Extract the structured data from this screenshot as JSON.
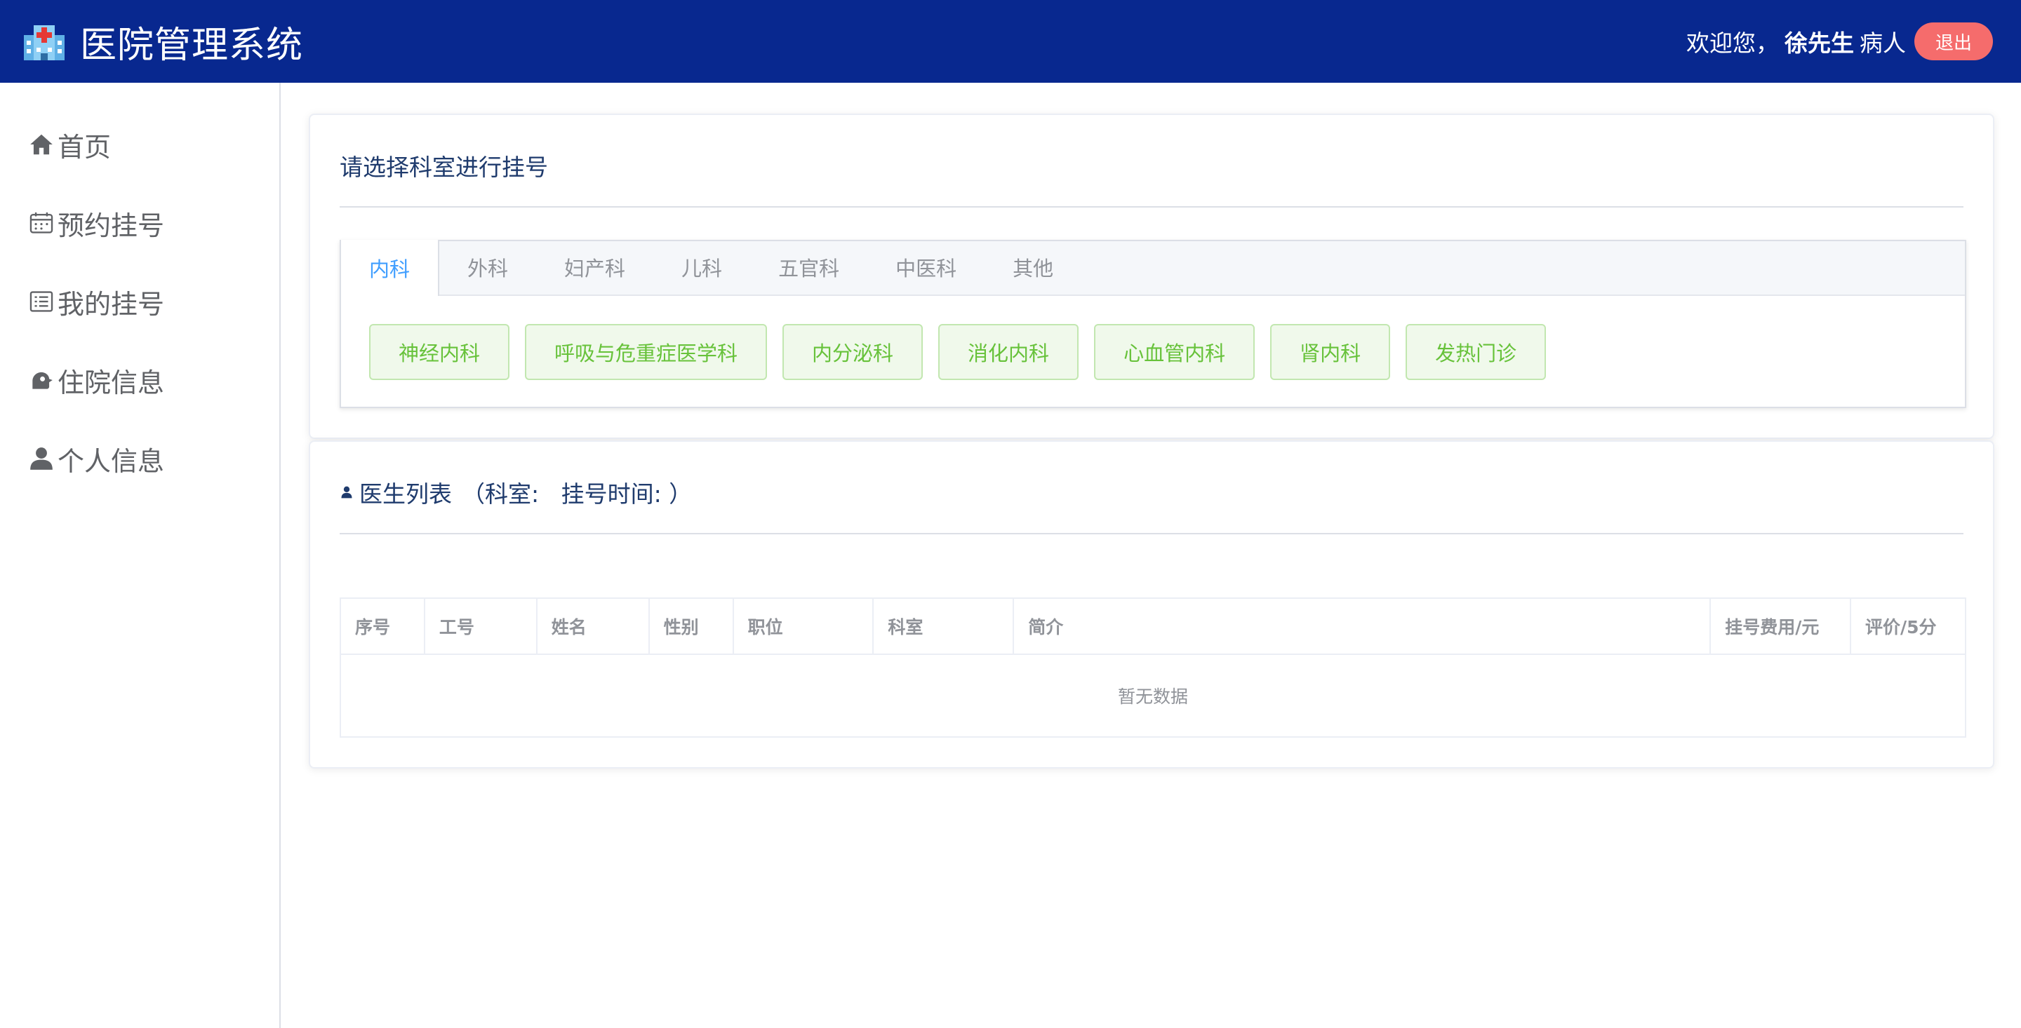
{
  "header": {
    "title": "医院管理系统",
    "welcome": "欢迎您，",
    "user_name": "徐先生",
    "role": "病人",
    "logout_label": "退出"
  },
  "sidebar": {
    "items": [
      {
        "label": "首页",
        "icon": "home-icon"
      },
      {
        "label": "预约挂号",
        "icon": "calendar-icon"
      },
      {
        "label": "我的挂号",
        "icon": "list-icon"
      },
      {
        "label": "住院信息",
        "icon": "bed-icon"
      },
      {
        "label": " 个人信息",
        "icon": "user-icon"
      }
    ]
  },
  "department_card": {
    "title": "请选择科室进行挂号",
    "tabs": [
      "内科",
      "外科",
      "妇产科",
      "儿科",
      "五官科",
      "中医科",
      "其他"
    ],
    "active_tab": "内科",
    "departments": [
      "神经内科",
      "呼吸与危重症医学科",
      "内分泌科",
      "消化内科",
      "心血管内科",
      "肾内科",
      "发热门诊"
    ]
  },
  "doctor_card": {
    "title": "医生列表",
    "subtitle": "（科室:   挂号时间: ）",
    "columns": [
      "序号",
      "工号",
      "姓名",
      "性别",
      "职位",
      "科室",
      "简介",
      "挂号费用/元",
      "评价/5分"
    ],
    "empty_text": "暂无数据"
  },
  "colors": {
    "header_bg": "#08288f",
    "logout_bg": "#f56c6c",
    "active_tab": "#409eff",
    "dept_button_text": "#67c23a",
    "dept_button_bg": "#f0f9eb"
  }
}
